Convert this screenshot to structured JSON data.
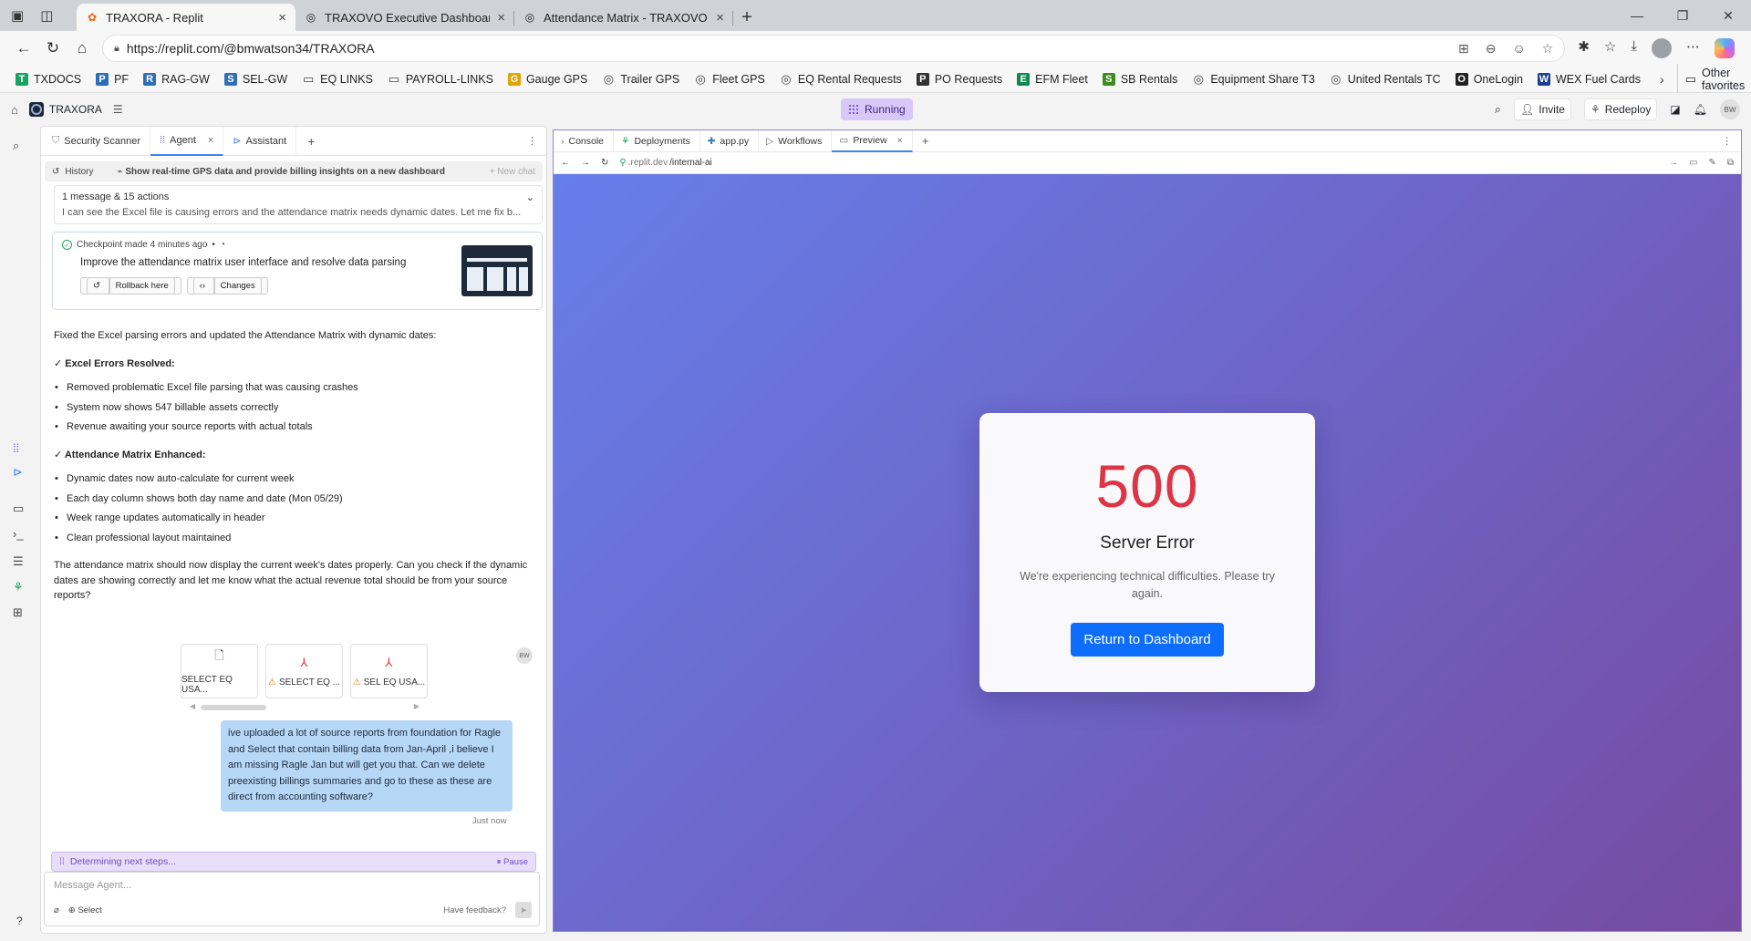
{
  "browser": {
    "tabs": [
      {
        "title": "TRAXORA - Replit",
        "favicon": "replit-icon",
        "active": true
      },
      {
        "title": "TRAXOVO Executive Dashboard",
        "favicon": "globe-icon",
        "active": false
      },
      {
        "title": "Attendance Matrix - TRAXOVO",
        "favicon": "globe-icon",
        "active": false
      }
    ],
    "url": "https://replit.com/@bmwatson34/TRAXORA",
    "bookmarks": [
      {
        "label": "TXDOCS",
        "color": "#1aa260"
      },
      {
        "label": "PF",
        "color": "#2d6fb7"
      },
      {
        "label": "RAG-GW",
        "color": "#2d6fb7"
      },
      {
        "label": "SEL-GW",
        "color": "#2d6fb7"
      },
      {
        "label": "EQ LINKS",
        "color": "folder"
      },
      {
        "label": "PAYROLL-LINKS",
        "color": "folder"
      },
      {
        "label": "Gauge GPS",
        "color": "#e0a400"
      },
      {
        "label": "Trailer GPS",
        "color": "globe"
      },
      {
        "label": "Fleet GPS",
        "color": "globe"
      },
      {
        "label": "EQ Rental Requests",
        "color": "globe"
      },
      {
        "label": "PO Requests",
        "color": "#333333"
      },
      {
        "label": "EFM Fleet",
        "color": "#0d8a4c"
      },
      {
        "label": "SB Rentals",
        "color": "#3d8c1e"
      },
      {
        "label": "Equipment Share T3",
        "color": "globe"
      },
      {
        "label": "United Rentals TC",
        "color": "globe"
      },
      {
        "label": "OneLogin",
        "color": "#222222"
      },
      {
        "label": "WEX Fuel Cards",
        "color": "#1c3f94"
      }
    ],
    "other_favorites": "Other favorites"
  },
  "replit": {
    "project": "TRAXORA",
    "status": "Running",
    "invite": "Invite",
    "redeploy": "Redeploy",
    "avatar": "BW"
  },
  "agent": {
    "tabs": [
      {
        "label": "Security Scanner"
      },
      {
        "label": "Agent"
      },
      {
        "label": "Assistant"
      }
    ],
    "history_label": "History",
    "chat_title": "Show real-time GPS data and provide billing insights on a new dashboard",
    "new_chat": "+ New chat",
    "summary_head": "1 message & 15 actions",
    "summary_text": "I can see the Excel file is causing errors and the attendance matrix needs dynamic dates. Let me fix b...",
    "checkpoint_meta": "Checkpoint made 4 minutes ago",
    "checkpoint_title": "Improve the attendance matrix user interface and resolve data parsing",
    "rollback": "Rollback here",
    "changes": "Changes",
    "intro": "Fixed the Excel parsing errors and updated the Attendance Matrix with dynamic dates:",
    "section1_title": "✓ Excel Errors Resolved:",
    "section1_items": [
      "Removed problematic Excel file parsing that was causing crashes",
      "System now shows 547 billable assets correctly",
      "Revenue awaiting your source reports with actual totals"
    ],
    "section2_title": "✓ Attendance Matrix Enhanced:",
    "section2_items": [
      "Dynamic dates now auto-calculate for current week",
      "Each day column shows both day name and date (Mon 05/29)",
      "Week range updates automatically in header",
      "Clean professional layout maintained"
    ],
    "closing": "The attendance matrix should now display the current week's dates properly. Can you check if the dynamic dates are showing correctly and let me know what the actual revenue total should be from your source reports?",
    "attachments": [
      {
        "label": "SELECT EQ USA...",
        "type": "file"
      },
      {
        "label": "SELECT EQ ...",
        "type": "pdf"
      },
      {
        "label": "SEL EQ USA...",
        "type": "pdf"
      }
    ],
    "user_avatar": "BW",
    "user_message": "ive uploaded a lot of source reports from foundation for Ragle and Select that contain billing data from Jan-April ,i believe I am missing Ragle Jan but will get you that. Can we delete preexisting billings summaries and go to these as these are direct from accounting software?",
    "timestamp": "Just now",
    "thinking": "Determining next steps...",
    "pause": "⏸ Pause",
    "composer_placeholder": "Message Agent...",
    "select": "Select",
    "feedback": "Have feedback?"
  },
  "preview": {
    "tabs": [
      {
        "label": "Console"
      },
      {
        "label": "Deployments"
      },
      {
        "label": "app.py"
      },
      {
        "label": "Workflows"
      },
      {
        "label": "Preview"
      }
    ],
    "url_domain": ".replit.dev",
    "url_path": "/internal-ai",
    "error": {
      "code": "500",
      "title": "Server Error",
      "message": "We're experiencing technical difficulties. Please try again.",
      "button": "Return to Dashboard"
    }
  },
  "colors": {
    "gradient_start": "#667eea",
    "gradient_end": "#764ba2",
    "error_red": "#dc3545",
    "button_blue": "#0d6efd"
  }
}
